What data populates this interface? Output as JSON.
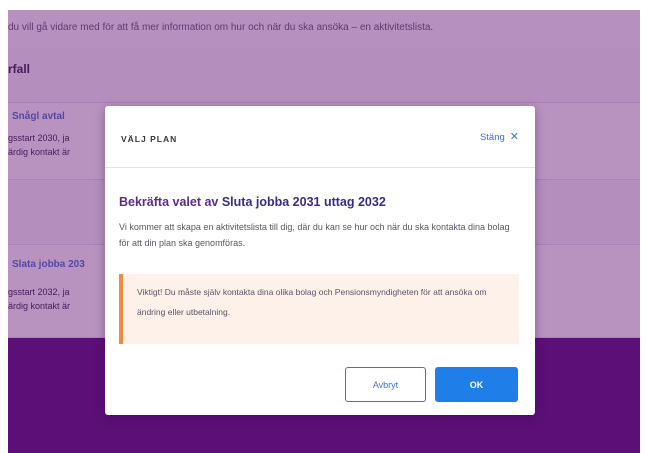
{
  "background": {
    "intro_text": "du vill gå vidare med för att få mer information om hur och när du ska ansöka – en aktivitetslista.",
    "section_title": "rfall",
    "cards": [
      {
        "link": "Snågl avtal",
        "line1": "gsstart 2030, ja",
        "line2": "ärdig kontakt är"
      },
      {
        "link": "Slata jobba 203",
        "line1": "gsstart 2032, ja",
        "line2": "ärdig kontakt är"
      }
    ]
  },
  "modal": {
    "heading": "VÄLJ PLAN",
    "close_label": "Stäng",
    "title_prefix": "Bekräfta valet av ",
    "title_plan": "Sluta jobba 2031 uttag 2032",
    "body": "Vi kommer att skapa en aktivitetslista till dig, där du kan se hur och när du ska kontakta dina bolag för att din plan ska genomföras.",
    "warning": "Viktigt! Du måste själv kontakta dina olika bolag och Pensionsmyndigheten för att ansöka om ändring eller utbetalning.",
    "cancel_label": "Avbryt",
    "ok_label": "OK"
  },
  "colors": {
    "overlay": "#5c0a6e",
    "accent_blue": "#1f7ee8",
    "link_blue": "#3f6fd8",
    "warning_stripe": "#f08a3c",
    "title_purple": "#5a2d8a"
  },
  "icons": {
    "close": "close-icon"
  }
}
